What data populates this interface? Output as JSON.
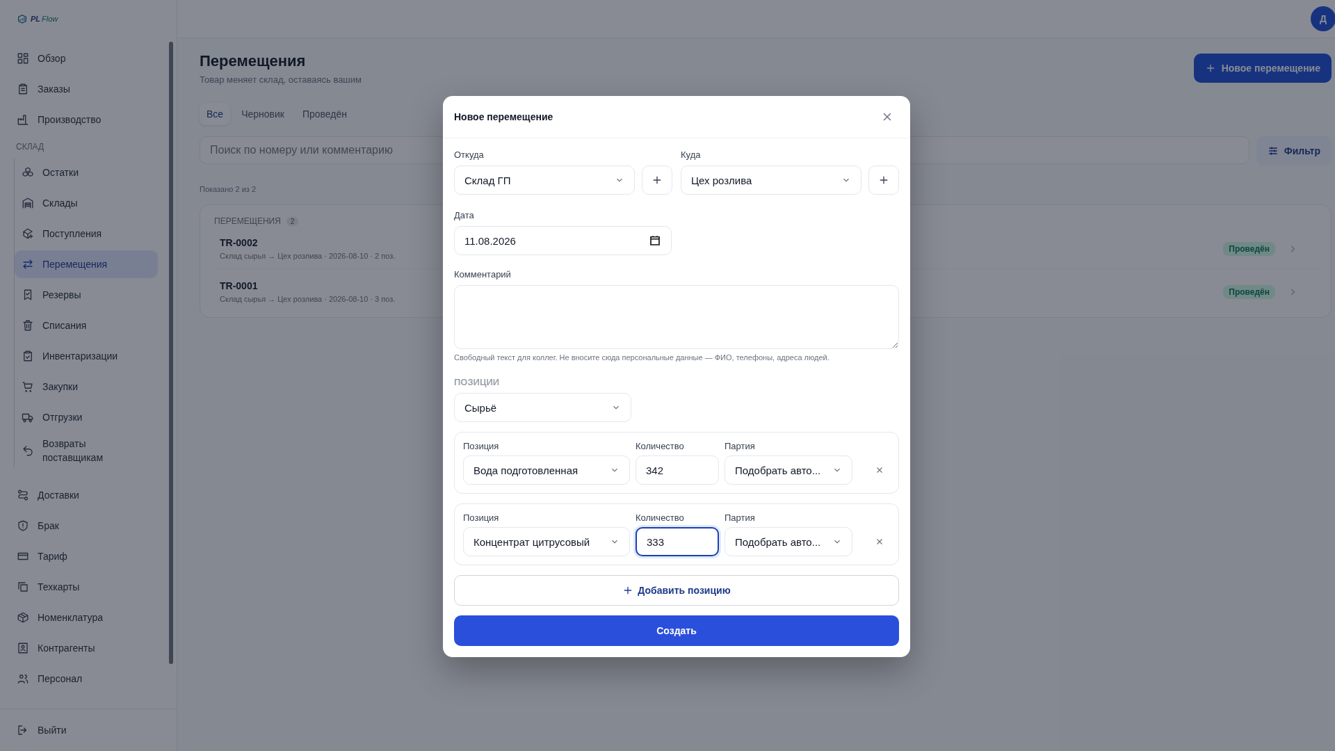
{
  "logo": {
    "part1": "PL",
    "part2": "Flow"
  },
  "sidebar": {
    "top": [
      {
        "label": "Обзор",
        "selected": false
      },
      {
        "label": "Заказы",
        "selected": false
      },
      {
        "label": "Производство",
        "selected": false
      }
    ],
    "section": {
      "title": "СКЛАД",
      "items": [
        {
          "label": "Остатки",
          "selected": false
        },
        {
          "label": "Склады",
          "selected": false
        },
        {
          "label": "Поступления",
          "selected": false
        },
        {
          "label": "Перемещения",
          "selected": true
        },
        {
          "label": "Резервы",
          "selected": false
        },
        {
          "label": "Списания",
          "selected": false
        },
        {
          "label": "Инвентаризации",
          "selected": false
        },
        {
          "label": "Закупки",
          "selected": false
        },
        {
          "label": "Отгрузки",
          "selected": false
        },
        {
          "label": "Возвраты поставщикам",
          "selected": false
        }
      ]
    },
    "bottom": [
      {
        "label": "Доставки",
        "selected": false
      },
      {
        "label": "Брак",
        "selected": false
      },
      {
        "label": "Тариф",
        "selected": false
      },
      {
        "label": "Техкарты",
        "selected": false
      },
      {
        "label": "Номенклатура",
        "selected": false
      },
      {
        "label": "Контрагенты",
        "selected": false
      },
      {
        "label": "Персонал",
        "selected": false
      }
    ],
    "logout": "Выйти"
  },
  "header": {
    "avatar": "Д"
  },
  "page": {
    "title": "Перемещения",
    "subtitle": "Товар меняет склад, оставаясь вашим",
    "new_button": "Новое перемещение",
    "tabs": [
      {
        "label": "Все",
        "selected": true
      },
      {
        "label": "Черновик",
        "selected": false
      },
      {
        "label": "Проведён",
        "selected": false
      }
    ],
    "search": {
      "placeholder": "Поиск по номеру или комментарию"
    },
    "filter_button": "Фильтр",
    "shown": "Показано 2 из 2",
    "list": {
      "title": "ПЕРЕМЕЩЕНИЯ",
      "count": "2",
      "rows": [
        {
          "number": "TR-0002",
          "details": "Склад сырья → Цех розлива · 2026-08-10 · 2 поз.",
          "status": "Проведён"
        },
        {
          "number": "TR-0001",
          "details": "Склад сырья → Цех розлива · 2026-08-10 · 3 поз.",
          "status": "Проведён"
        }
      ]
    }
  },
  "modal": {
    "title": "Новое перемещение",
    "from": {
      "label": "Откуда",
      "value": "Склад ГП"
    },
    "to": {
      "label": "Куда",
      "value": "Цех розлива"
    },
    "date": {
      "label": "Дата",
      "value": "11.08.2026"
    },
    "comment": {
      "label": "Комментарий",
      "hint": "Свободный текст для коллег. Не вносите сюда персональные данные — ФИО, телефоны, адреса людей."
    },
    "positions": {
      "title": "ПОЗИЦИИ",
      "category": "Сырьё",
      "lines": [
        {
          "position_label": "Позиция",
          "position": "Вода подготовленная",
          "qty_label": "Количество",
          "qty": "342",
          "focused": false,
          "batch_label": "Партия",
          "batch": "Подобрать авто..."
        },
        {
          "position_label": "Позиция",
          "position": "Концентрат цитрусовый",
          "qty_label": "Количество",
          "qty": "333",
          "focused": true,
          "batch_label": "Партия",
          "batch": "Подобрать авто..."
        }
      ]
    },
    "add_button": "Добавить позицию",
    "submit": "Создать"
  }
}
